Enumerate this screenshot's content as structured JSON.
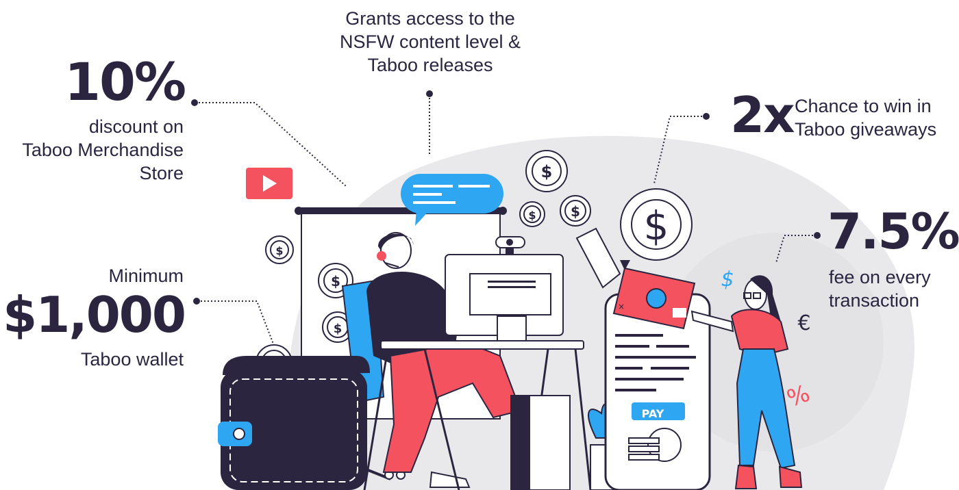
{
  "features": {
    "discount": {
      "value": "10%",
      "line1": "discount on",
      "line2": "Taboo Merchandise",
      "line3": "Store"
    },
    "access": {
      "line1": "Grants access to the",
      "line2": "NSFW content level &",
      "line3": "Taboo releases"
    },
    "giveaway": {
      "value": "2x",
      "line1": "Chance to win in",
      "line2": "Taboo giveaways"
    },
    "fee": {
      "value": "7.5%",
      "line1": "fee on every",
      "line2": "transaction"
    },
    "wallet": {
      "line1": "Minimum",
      "value": "$1,000",
      "line2": "Taboo wallet"
    }
  },
  "illustration": {
    "pay_label": "PAY",
    "euro_symbol": "€",
    "percent_symbol": "%",
    "dollar_symbol": "$",
    "close_symbol": "×"
  },
  "colors": {
    "dark": "#2b2540",
    "coral": "#f4525f",
    "blue": "#2ea6f2",
    "grey": "#e9e9ec"
  }
}
